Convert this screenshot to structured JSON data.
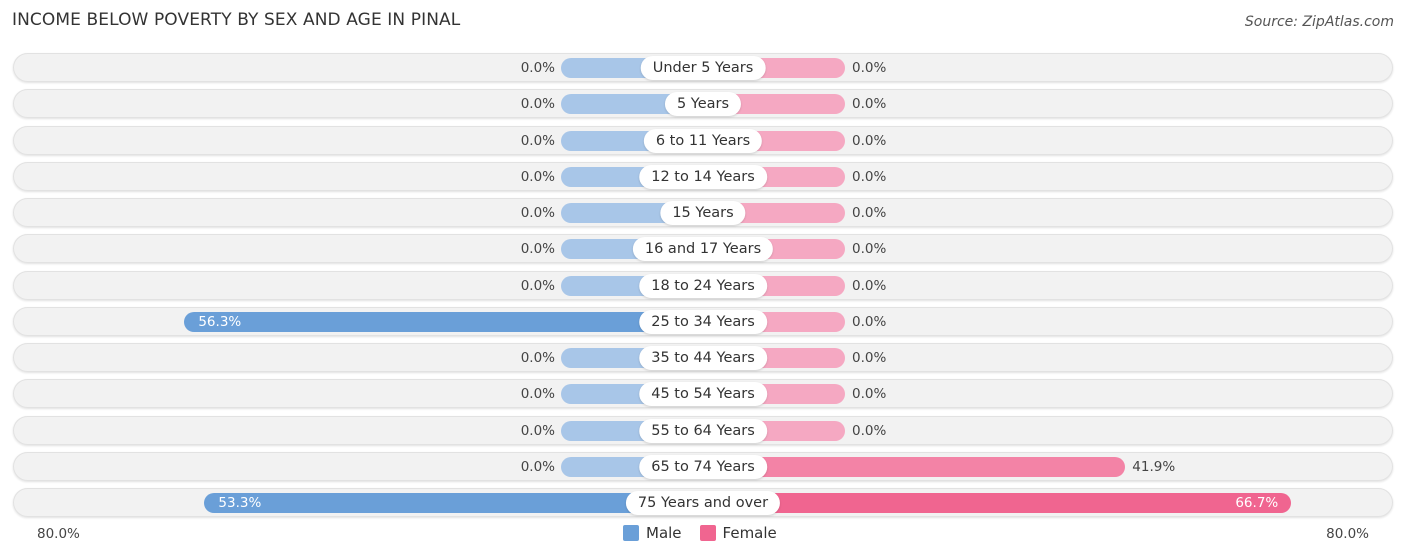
{
  "header": {
    "title": "INCOME BELOW POVERTY BY SEX AND AGE IN PINAL",
    "source": "Source: ZipAtlas.com"
  },
  "colors": {
    "male": "#6a9fd8",
    "male_light": "#a8c6e8",
    "female": "#f06590",
    "female_light": "#f5a8c2"
  },
  "chart_data": {
    "type": "bar",
    "title": "INCOME BELOW POVERTY BY SEX AND AGE IN PINAL",
    "orientation": "horizontal-diverging",
    "categories": [
      "Under 5 Years",
      "5 Years",
      "6 to 11 Years",
      "12 to 14 Years",
      "15 Years",
      "16 and 17 Years",
      "18 to 24 Years",
      "25 to 34 Years",
      "35 to 44 Years",
      "45 to 54 Years",
      "55 to 64 Years",
      "65 to 74 Years",
      "75 Years and over"
    ],
    "series": [
      {
        "name": "Male",
        "values": [
          0.0,
          0.0,
          0.0,
          0.0,
          0.0,
          0.0,
          0.0,
          56.3,
          0.0,
          0.0,
          0.0,
          0.0,
          53.3
        ]
      },
      {
        "name": "Female",
        "values": [
          0.0,
          0.0,
          0.0,
          0.0,
          0.0,
          0.0,
          0.0,
          0.0,
          0.0,
          0.0,
          0.0,
          41.9,
          66.7
        ]
      }
    ],
    "value_labels": {
      "male": [
        "0.0%",
        "0.0%",
        "0.0%",
        "0.0%",
        "0.0%",
        "0.0%",
        "0.0%",
        "56.3%",
        "0.0%",
        "0.0%",
        "0.0%",
        "0.0%",
        "53.3%"
      ],
      "female": [
        "0.0%",
        "0.0%",
        "0.0%",
        "0.0%",
        "0.0%",
        "0.0%",
        "0.0%",
        "0.0%",
        "0.0%",
        "0.0%",
        "0.0%",
        "41.9%",
        "66.7%"
      ]
    },
    "xlim": [
      0,
      80
    ],
    "axis_labels": {
      "left": "80.0%",
      "right": "80.0%"
    },
    "legend": {
      "position": "bottom-center",
      "entries": [
        "Male",
        "Female"
      ]
    },
    "xlabel": "",
    "ylabel": ""
  }
}
